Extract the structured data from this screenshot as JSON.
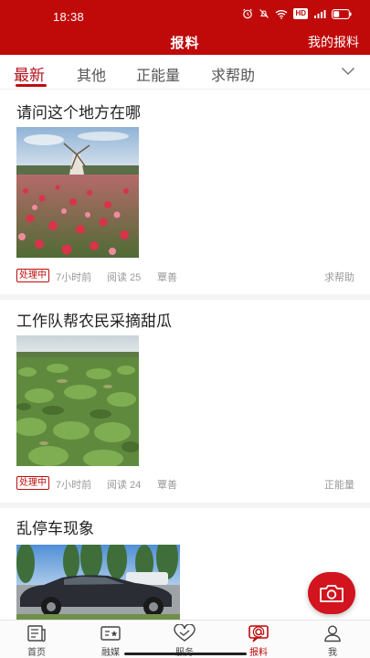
{
  "status_bar": {
    "time": "18:38",
    "icons": [
      "alarm-icon",
      "mute-icon",
      "wifi-icon",
      "hd-badge",
      "signal-4g-icon",
      "battery-icon"
    ],
    "hd_label": "HD"
  },
  "header": {
    "title": "报料",
    "my_report_label": "我的报料",
    "background_color": "#c00a0a"
  },
  "tabs": {
    "items": [
      {
        "label": "最新",
        "active": true
      },
      {
        "label": "其他",
        "active": false
      },
      {
        "label": "正能量",
        "active": false
      },
      {
        "label": "求帮助",
        "active": false
      }
    ],
    "expand_icon": "chevron-down-icon"
  },
  "feed": {
    "posts": [
      {
        "title": "请问这个地方在哪",
        "image": "flower-field-windmill-photo",
        "status": "处理中",
        "time": "7小时前",
        "reads": "阅读 25",
        "author": "覃善",
        "category": "求帮助"
      },
      {
        "title": "工作队帮农民采摘甜瓜",
        "image": "melon-field-photo",
        "status": "处理中",
        "time": "7小时前",
        "reads": "阅读 24",
        "author": "覃善",
        "category": "正能量"
      },
      {
        "title": "乱停车现象",
        "image": "parked-car-photo"
      }
    ]
  },
  "camera_button": {
    "icon": "camera-icon",
    "color": "#d2141e"
  },
  "bottom_nav": {
    "items": [
      {
        "label": "首页",
        "icon": "newspaper-icon",
        "active": false
      },
      {
        "label": "融媒",
        "icon": "media-icon",
        "active": false
      },
      {
        "label": "服务",
        "icon": "service-heart-icon",
        "active": false
      },
      {
        "label": "报料",
        "icon": "report-chat-icon",
        "active": true
      },
      {
        "label": "我",
        "icon": "user-icon",
        "active": false
      }
    ],
    "active_color": "#c00a0a"
  }
}
